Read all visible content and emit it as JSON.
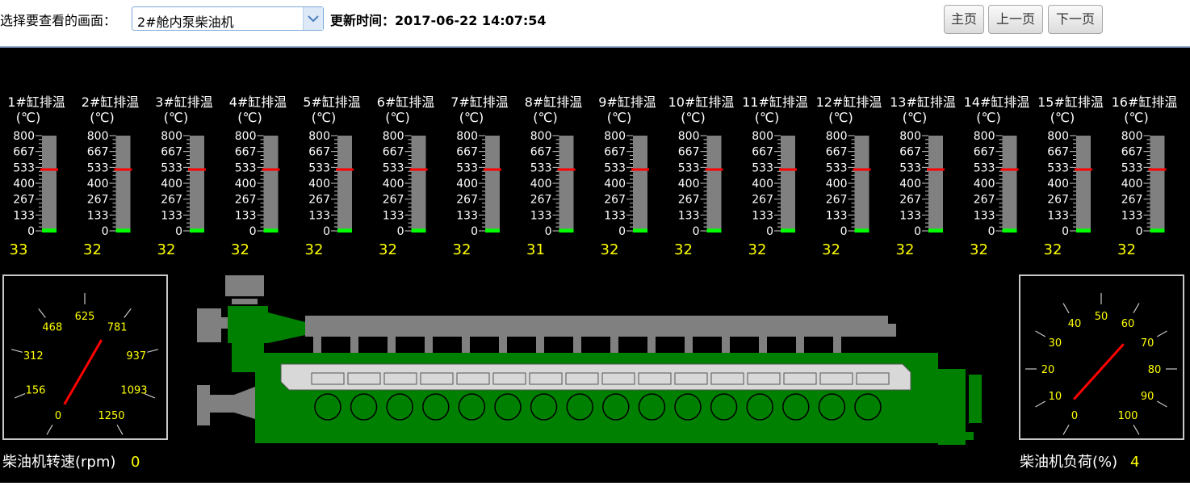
{
  "toolbar": {
    "select_label": "选择要查看的画面：",
    "selected_screen": "2#舱内泵柴油机",
    "update_time_label": "更新时间：",
    "update_time": "2017-06-22 14:07:54",
    "buttons": {
      "home": "主页",
      "prev": "上一页",
      "next": "下一页"
    }
  },
  "colors": {
    "panel_bg": "#000000",
    "engine_green": "#008000",
    "machine_gray": "#808080",
    "value_yellow": "#ffff00",
    "needle_red": "#ff0000",
    "level_green": "#00ff00"
  },
  "cylinders": {
    "unit": "(℃)",
    "scale_ticks": [
      "800",
      "667",
      "533",
      "400",
      "267",
      "133",
      "0"
    ],
    "scale_max": 800,
    "alarm_value": 520,
    "items": [
      {
        "label": "1#缸排温",
        "value": "33"
      },
      {
        "label": "2#缸排温",
        "value": "32"
      },
      {
        "label": "3#缸排温",
        "value": "32"
      },
      {
        "label": "4#缸排温",
        "value": "32"
      },
      {
        "label": "5#缸排温",
        "value": "32"
      },
      {
        "label": "6#缸排温",
        "value": "32"
      },
      {
        "label": "7#缸排温",
        "value": "32"
      },
      {
        "label": "8#缸排温",
        "value": "31"
      },
      {
        "label": "9#缸排温",
        "value": "32"
      },
      {
        "label": "10#缸排温",
        "value": "32"
      },
      {
        "label": "11#缸排温",
        "value": "32"
      },
      {
        "label": "12#缸排温",
        "value": "32"
      },
      {
        "label": "13#缸排温",
        "value": "32"
      },
      {
        "label": "14#缸排温",
        "value": "32"
      },
      {
        "label": "15#缸排温",
        "value": "32"
      },
      {
        "label": "16#缸排温",
        "value": "32"
      }
    ]
  },
  "speed_gauge": {
    "label": "柴油机转速(rpm)",
    "value": "0",
    "ticks": [
      "0",
      "156",
      "312",
      "468",
      "625",
      "781",
      "937",
      "1093",
      "1250"
    ],
    "min": 0,
    "max": 1250
  },
  "load_gauge": {
    "label": "柴油机负荷(%)",
    "value": "4",
    "ticks": [
      "0",
      "10",
      "20",
      "30",
      "40",
      "50",
      "60",
      "70",
      "80",
      "90",
      "100"
    ],
    "min": 0,
    "max": 100
  }
}
